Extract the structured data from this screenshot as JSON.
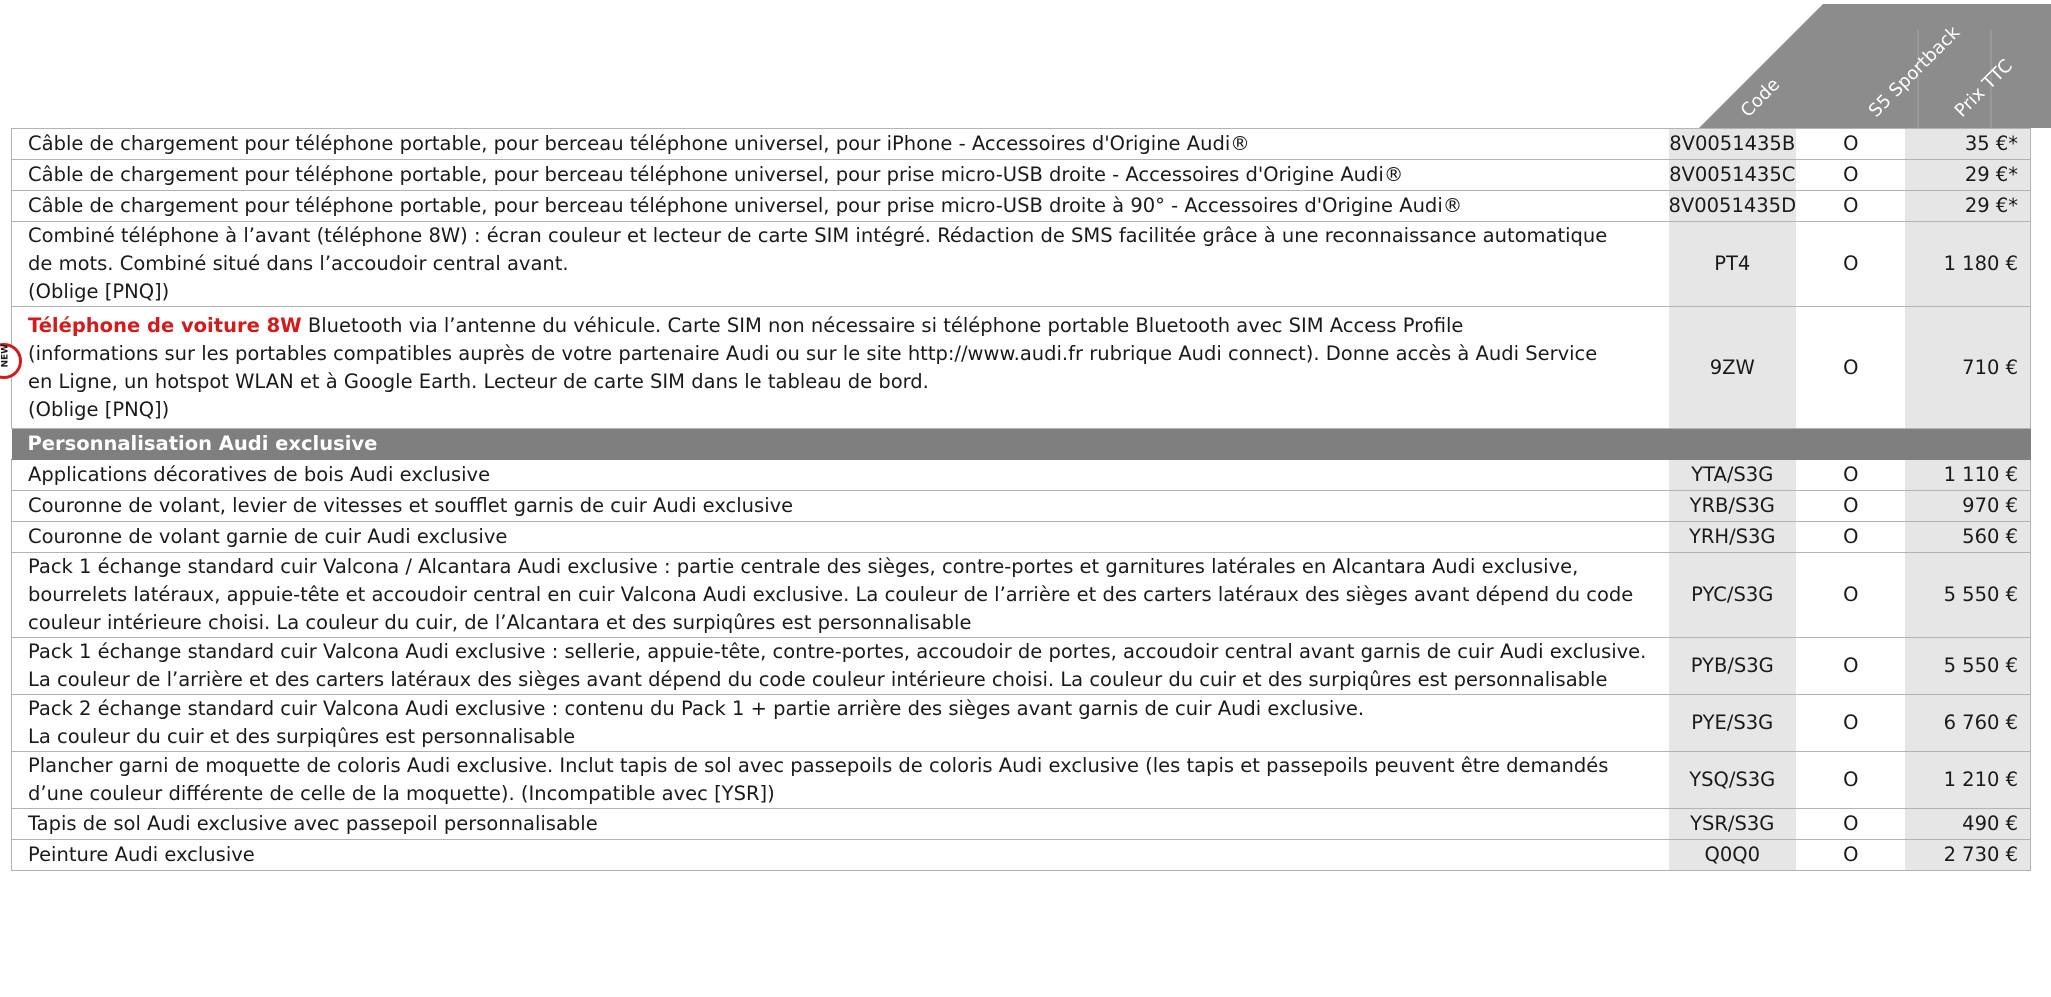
{
  "header": {
    "columns": [
      "Code",
      "S5 Sportback",
      "Prix TTC"
    ],
    "colors": {
      "band": "#8c8c8c",
      "band_light": "#bdbdbd"
    }
  },
  "badge": {
    "icon": "new-badge-icon",
    "text": "NEW",
    "color": "#d61a1a"
  },
  "rows": [
    {
      "type": "item",
      "description": "Câble de chargement pour téléphone portable, pour berceau téléphone universel, pour iPhone - Accessoires d'Origine Audi®",
      "code": "8V0051435B",
      "availability": "O",
      "price": "35 €*"
    },
    {
      "type": "item",
      "description": "Câble de chargement pour téléphone portable, pour berceau téléphone universel, pour prise micro-USB droite - Accessoires d'Origine Audi®",
      "code": "8V0051435C",
      "availability": "O",
      "price": "29 €*"
    },
    {
      "type": "item",
      "description": "Câble de chargement pour téléphone portable, pour berceau téléphone universel, pour prise micro-USB droite à 90° - Accessoires d'Origine Audi®",
      "code": "8V0051435D",
      "availability": "O",
      "price": "29 €*"
    },
    {
      "type": "item",
      "description": "Combiné téléphone à l’avant (téléphone 8W) : écran couleur et lecteur de carte SIM intégré. Rédaction de SMS facilitée grâce à une reconnaissance automatique\nde mots. Combiné situé dans l’accoudoir central avant.\n(Oblige [PNQ])",
      "code": "PT4",
      "availability": "O",
      "price": "1 180 €"
    },
    {
      "type": "item",
      "highlight": "Téléphone de voiture 8W",
      "description": " Bluetooth via l’antenne du véhicule. Carte SIM non nécessaire si téléphone portable Bluetooth avec SIM Access Profile\n(informations sur les portables compatibles auprès de votre partenaire Audi ou sur le site http://www.audi.fr rubrique Audi connect). Donne accès à Audi Service\nen Ligne, un hotspot WLAN et à Google Earth. Lecteur de carte SIM dans le tableau de bord.\n(Oblige [PNQ])",
      "code": "9ZW",
      "availability": "O",
      "price": "710 €"
    },
    {
      "type": "section",
      "title": "Personnalisation Audi exclusive"
    },
    {
      "type": "item",
      "description": "Applications décoratives de bois Audi exclusive",
      "code": "YTA/S3G",
      "availability": "O",
      "price": "1 110 €"
    },
    {
      "type": "item",
      "description": "Couronne de volant, levier de vitesses et soufflet garnis de cuir Audi exclusive",
      "code": "YRB/S3G",
      "availability": "O",
      "price": "970 €"
    },
    {
      "type": "item",
      "description": "Couronne de volant garnie de cuir Audi exclusive",
      "code": "YRH/S3G",
      "availability": "O",
      "price": "560 €"
    },
    {
      "type": "item",
      "description": "Pack 1 échange standard cuir Valcona / Alcantara Audi exclusive : partie centrale des sièges, contre-portes et garnitures latérales en Alcantara Audi exclusive,\nbourrelets latéraux, appuie-tête et accoudoir central en cuir Valcona Audi exclusive. La couleur de l’arrière et des carters latéraux des sièges avant dépend du code\ncouleur intérieure choisi. La couleur du cuir, de l’Alcantara et des surpiqûres est personnalisable",
      "code": "PYC/S3G",
      "availability": "O",
      "price": "5 550 €"
    },
    {
      "type": "item",
      "description": "Pack 1 échange standard cuir Valcona Audi exclusive : sellerie, appuie-tête, contre-portes, accoudoir de portes, accoudoir central avant garnis de cuir Audi exclusive.\nLa couleur de l’arrière et des carters latéraux des sièges avant dépend du code couleur intérieure choisi. La couleur du cuir et des surpiqûres est personnalisable",
      "code": "PYB/S3G",
      "availability": "O",
      "price": "5 550 €"
    },
    {
      "type": "item",
      "description": "Pack 2 échange standard cuir Valcona Audi exclusive : contenu du Pack 1 + partie arrière des sièges avant garnis de cuir Audi exclusive.\nLa couleur du cuir et des surpiqûres est personnalisable",
      "code": "PYE/S3G",
      "availability": "O",
      "price": "6 760 €"
    },
    {
      "type": "item",
      "description": "Plancher garni de moquette de coloris Audi exclusive. Inclut tapis de sol avec passepoils de coloris Audi exclusive (les tapis et passepoils peuvent être demandés\nd’une couleur différente de celle de la moquette). (Incompatible avec [YSR])",
      "code": "YSQ/S3G",
      "availability": "O",
      "price": "1 210 €"
    },
    {
      "type": "item",
      "description": "Tapis de sol Audi exclusive avec passepoil personnalisable",
      "code": "YSR/S3G",
      "availability": "O",
      "price": "490 €"
    },
    {
      "type": "item",
      "description": "Peinture Audi exclusive",
      "code": "Q0Q0",
      "availability": "O",
      "price": "2 730 €"
    }
  ]
}
